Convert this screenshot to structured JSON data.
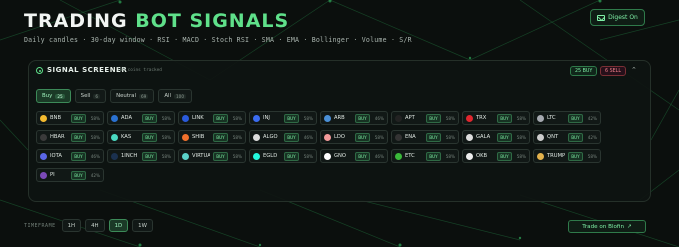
{
  "header": {
    "title_main": "TRADING ",
    "title_accent": "BOT SIGNALS",
    "subtitle": "Daily candles · 30-day window · RSI · MACD · Stoch RSI · SMA · EMA · Bollinger · Volume · S/R",
    "digest_label": "Digest On"
  },
  "screener": {
    "title": "SIGNAL SCREENER",
    "tracked": "100 coins tracked",
    "buy_count": "25 BUY",
    "sell_count": "6 SELL"
  },
  "filters": [
    {
      "label": "Buy",
      "count": "25",
      "active": true
    },
    {
      "label": "Sell",
      "count": "6",
      "active": false
    },
    {
      "label": "Neutral",
      "count": "69",
      "active": false
    },
    {
      "label": "All",
      "count": "100",
      "active": false
    }
  ],
  "coins": [
    {
      "symbol": "BNB",
      "signal": "BUY",
      "pct": "58%",
      "color": "#f3ba2f"
    },
    {
      "symbol": "ADA",
      "signal": "BUY",
      "pct": "58%",
      "color": "#2a71d0"
    },
    {
      "symbol": "LINK",
      "signal": "BUY",
      "pct": "58%",
      "color": "#2a5ada"
    },
    {
      "symbol": "INJ",
      "signal": "BUY",
      "pct": "58%",
      "color": "#3b6cf0"
    },
    {
      "symbol": "ARB",
      "signal": "BUY",
      "pct": "46%",
      "color": "#4a8fd6"
    },
    {
      "symbol": "APT",
      "signal": "BUY",
      "pct": "58%",
      "color": "#222222"
    },
    {
      "symbol": "TRX",
      "signal": "BUY",
      "pct": "58%",
      "color": "#e0262e"
    },
    {
      "symbol": "LTC",
      "signal": "BUY",
      "pct": "42%",
      "color": "#a5a9b0"
    },
    {
      "symbol": "HBAR",
      "signal": "BUY",
      "pct": "58%",
      "color": "#3a3a3a"
    },
    {
      "symbol": "KAS",
      "signal": "BUY",
      "pct": "58%",
      "color": "#49d8c0"
    },
    {
      "symbol": "SHIB",
      "signal": "BUY",
      "pct": "58%",
      "color": "#f0702c"
    },
    {
      "symbol": "ALGO",
      "signal": "BUY",
      "pct": "46%",
      "color": "#dcdcdc"
    },
    {
      "symbol": "LDO",
      "signal": "BUY",
      "pct": "58%",
      "color": "#f29a9a"
    },
    {
      "symbol": "ENA",
      "signal": "BUY",
      "pct": "58%",
      "color": "#333333"
    },
    {
      "symbol": "GALA",
      "signal": "BUY",
      "pct": "58%",
      "color": "#dddddd"
    },
    {
      "symbol": "QNT",
      "signal": "BUY",
      "pct": "42%",
      "color": "#cccccc"
    },
    {
      "symbol": "IOTA",
      "signal": "BUY",
      "pct": "46%",
      "color": "#5a66e8"
    },
    {
      "symbol": "1INCH",
      "signal": "BUY",
      "pct": "58%",
      "color": "#1b314f"
    },
    {
      "symbol": "VIRTUAL",
      "signal": "BUY",
      "pct": "58%",
      "color": "#5ad1c8"
    },
    {
      "symbol": "EGLD",
      "signal": "BUY",
      "pct": "58%",
      "color": "#23f7dd"
    },
    {
      "symbol": "GNO",
      "signal": "BUY",
      "pct": "46%",
      "color": "#ffffff"
    },
    {
      "symbol": "ETC",
      "signal": "BUY",
      "pct": "58%",
      "color": "#3ab83a"
    },
    {
      "symbol": "OKB",
      "signal": "BUY",
      "pct": "58%",
      "color": "#eeeeee"
    },
    {
      "symbol": "TRUMP",
      "signal": "BUY",
      "pct": "58%",
      "color": "#e2b14c"
    },
    {
      "symbol": "PI",
      "signal": "BUY",
      "pct": "42%",
      "color": "#7b4ab8"
    }
  ],
  "timeframe": {
    "label": "TIMEFRAME",
    "options": [
      {
        "label": "1H",
        "active": false
      },
      {
        "label": "4H",
        "active": false
      },
      {
        "label": "1D",
        "active": true
      },
      {
        "label": "1W",
        "active": false
      }
    ]
  },
  "trade_button": {
    "label": "Trade on Blofin"
  },
  "colors": {
    "accent": "#5fe08a",
    "sell": "#f07f8a",
    "background": "#0b0f0d"
  }
}
